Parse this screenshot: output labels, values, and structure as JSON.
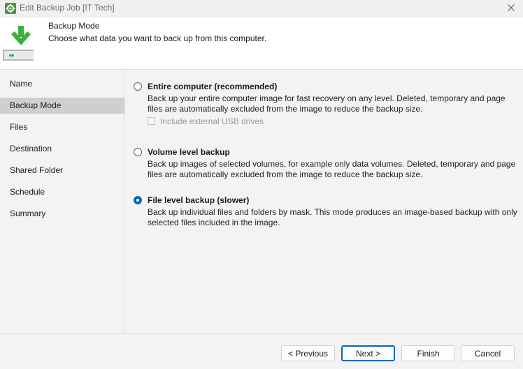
{
  "window": {
    "title": "Edit Backup Job [IT Tech]",
    "accent_color": "#0067c0",
    "app_icon": "gear-icon",
    "close_icon": "close-icon"
  },
  "header": {
    "title": "Backup Mode",
    "subtitle": "Choose what data you want to back up from this computer.",
    "icon": "download-drive-icon"
  },
  "sidebar": {
    "items": [
      {
        "label": "Name"
      },
      {
        "label": "Backup Mode"
      },
      {
        "label": "Files"
      },
      {
        "label": "Destination"
      },
      {
        "label": "Shared Folder"
      },
      {
        "label": "Schedule"
      },
      {
        "label": "Summary"
      }
    ],
    "active": "Backup Mode"
  },
  "options": {
    "entire": {
      "label": "Entire computer (recommended)",
      "description": "Back up your entire computer image for fast recovery on any level. Deleted, temporary and page files are automatically excluded from the image to reduce the backup size.",
      "selected": false,
      "usb": {
        "label": "Include external USB drives",
        "checked": false,
        "enabled": false
      }
    },
    "volume": {
      "label": "Volume level backup",
      "description": "Back up images of selected volumes, for example only data volumes. Deleted, temporary and page files are automatically excluded from the image to reduce the backup size.",
      "selected": false
    },
    "file": {
      "label": "File level backup (slower)",
      "description": "Back up individual files and folders by mask. This mode produces an image-based backup with only selected files included in the image.",
      "selected": true
    }
  },
  "footer": {
    "previous": "< Previous",
    "next": "Next >",
    "finish": "Finish",
    "cancel": "Cancel"
  }
}
